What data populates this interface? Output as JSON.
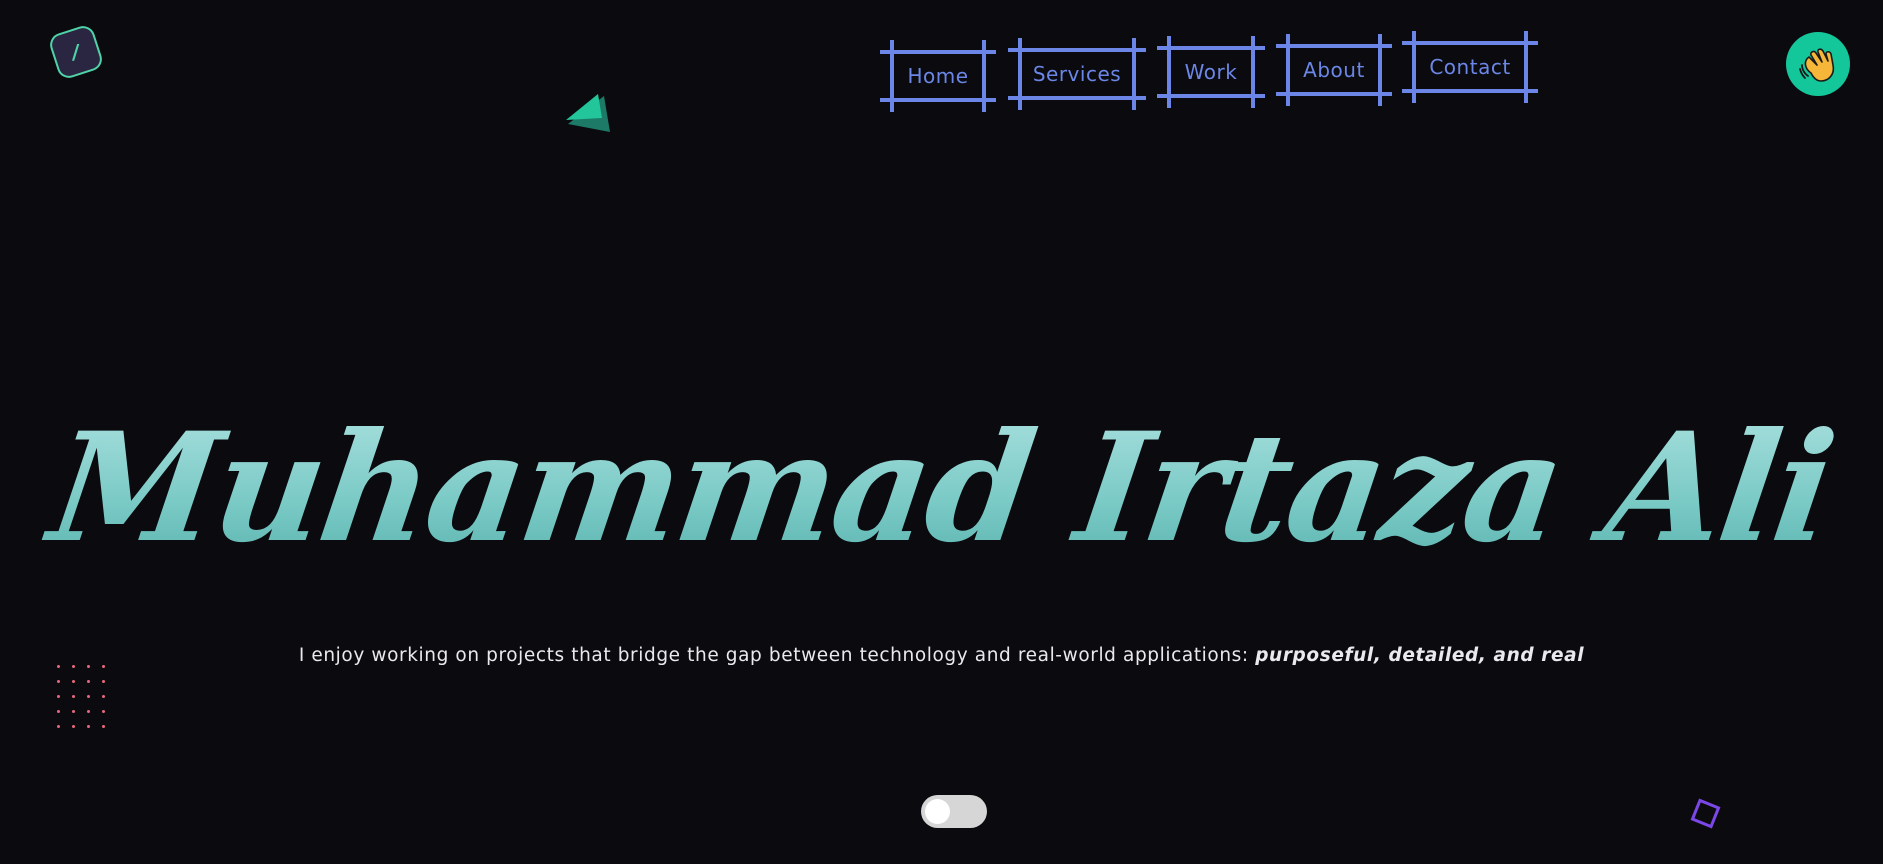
{
  "logo": {
    "glyph": "/",
    "icon": "logo-mark-icon"
  },
  "nav": {
    "items": [
      {
        "label": "Home"
      },
      {
        "label": "Services"
      },
      {
        "label": "Work"
      },
      {
        "label": "About"
      },
      {
        "label": "Contact"
      }
    ],
    "color": "#6b86e6"
  },
  "avatar": {
    "icon": "waving-hand-icon",
    "color": "#14c79a"
  },
  "hero": {
    "name": "Muhammad Irtaza Ali",
    "tagline_prefix": "I enjoy working on projects that bridge the gap between technology and real-world applications: ",
    "tagline_emphasis": "purposeful, detailed, and real"
  },
  "theme_toggle": {
    "state": "off"
  },
  "colors": {
    "background": "#0b0b0f",
    "name_gradient_top": "#a8e0de",
    "name_gradient_bottom": "#5ab3ae",
    "accent_green": "#14c79a",
    "dots": "#e8677f",
    "diamond": "#7b47e6"
  }
}
